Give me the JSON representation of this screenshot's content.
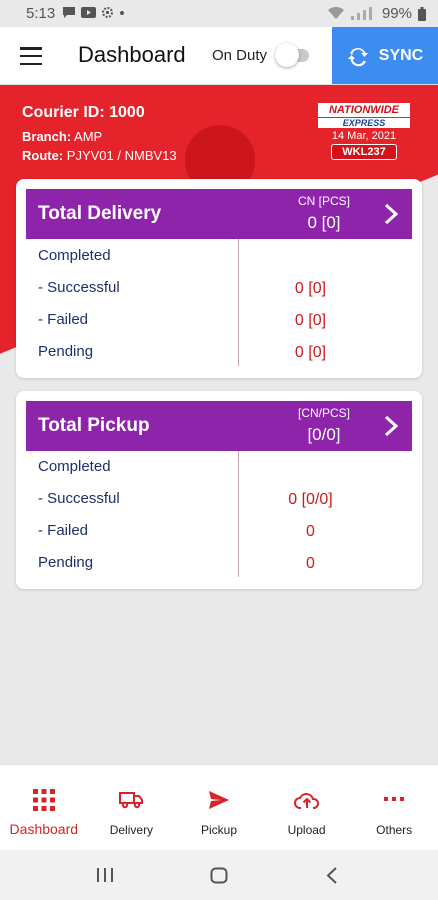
{
  "status_bar": {
    "time": "5:13",
    "battery": "99%"
  },
  "app_bar": {
    "title": "Dashboard",
    "duty_label": "On Duty",
    "sync_label": "SYNC"
  },
  "courier": {
    "id_label": "Courier ID: 1000",
    "branch_key": "Branch:",
    "branch_value": "AMP",
    "route_key": "Route:",
    "route_value": "PJYV01 / NMBV13"
  },
  "badge": {
    "brand": "NATIONWIDE",
    "brand_sub": "EXPRESS",
    "date": "14 Mar, 2021",
    "vehicle": "WKL237"
  },
  "delivery": {
    "title": "Total Delivery",
    "col_label": "CN [PCS]",
    "total": "0 [0]",
    "rows": [
      {
        "label": "Completed",
        "value": ""
      },
      {
        "label": "- Successful",
        "value": "0 [0]"
      },
      {
        "label": "- Failed",
        "value": "0 [0]"
      },
      {
        "label": "Pending",
        "value": "0 [0]"
      }
    ]
  },
  "pickup": {
    "title": "Total Pickup",
    "col_label": "[CN/PCS]",
    "total": "[0/0]",
    "rows": [
      {
        "label": "Completed",
        "value": ""
      },
      {
        "label": "- Successful",
        "value": "0 [0/0]"
      },
      {
        "label": "- Failed",
        "value": "0"
      },
      {
        "label": "Pending",
        "value": "0"
      }
    ]
  },
  "nav": [
    {
      "label": "Dashboard",
      "icon": "grid-icon",
      "active": true
    },
    {
      "label": "Delivery",
      "icon": "truck-icon",
      "active": false
    },
    {
      "label": "Pickup",
      "icon": "send-icon",
      "active": false
    },
    {
      "label": "Upload",
      "icon": "cloud-upload-icon",
      "active": false
    },
    {
      "label": "Others",
      "icon": "more-icon",
      "active": false
    }
  ],
  "colors": {
    "accent_red": "#e5232a",
    "card_header": "#8e24aa",
    "sync_blue": "#3d8cf0",
    "value_red": "#cc1a1a",
    "label_navy": "#1f2f6a"
  }
}
